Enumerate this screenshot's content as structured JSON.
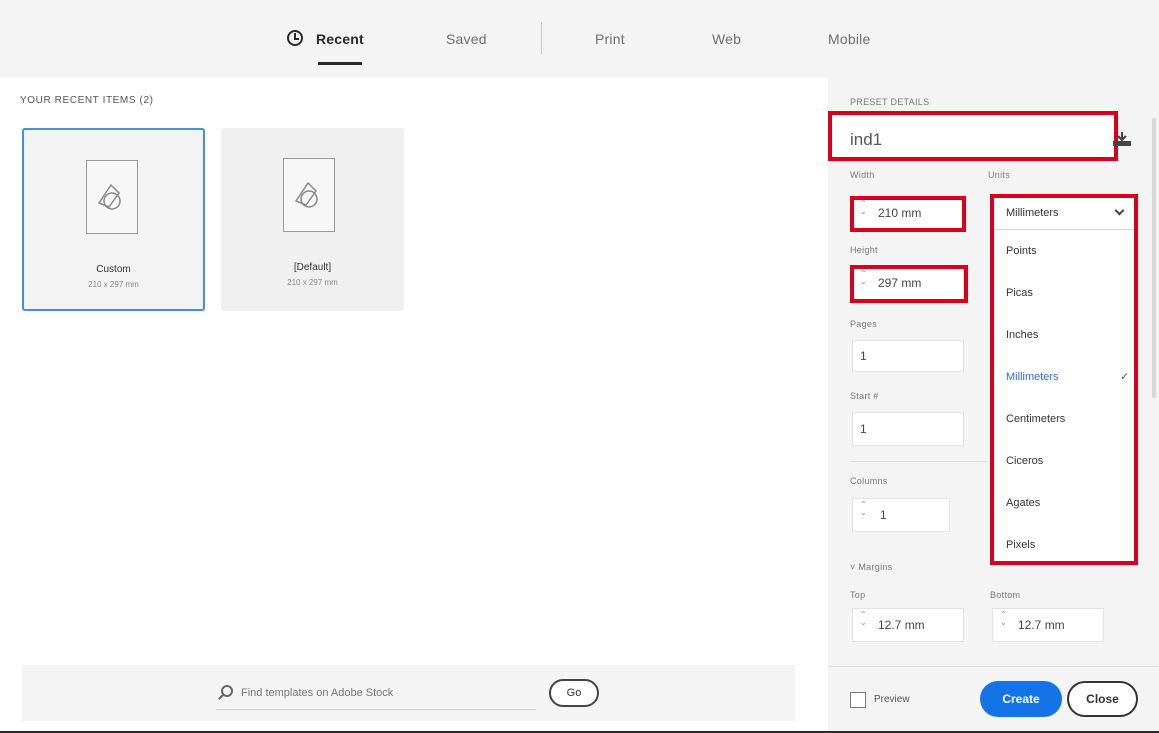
{
  "tabs": [
    {
      "label": "Recent",
      "active": true
    },
    {
      "label": "Saved",
      "active": false
    },
    {
      "label": "Print",
      "active": false
    },
    {
      "label": "Web",
      "active": false
    },
    {
      "label": "Mobile",
      "active": false
    }
  ],
  "recent": {
    "section_label": "YOUR RECENT ITEMS (2)",
    "items": [
      {
        "name": "Custom",
        "size": "210 x 297 mm"
      },
      {
        "name": "[Default]",
        "size": "210 x 297 mm"
      }
    ]
  },
  "search": {
    "placeholder": "Find templates on Adobe Stock",
    "go_label": "Go"
  },
  "preset": {
    "section_label": "PRESET DETAILS",
    "name": "ind1",
    "width_label": "Width",
    "width_value": "210 mm",
    "height_label": "Height",
    "height_value": "297 mm",
    "units_label": "Units",
    "pages_label": "Pages",
    "pages_value": "1",
    "start_label": "Start #",
    "start_value": "1",
    "columns_label": "Columns",
    "columns_value": "1",
    "margins_label": "Margins",
    "top_label": "Top",
    "top_value": "12.7 mm",
    "bottom_label": "Bottom",
    "bottom_value": "12.7 mm"
  },
  "units_dropdown": {
    "selected": "Millimeters",
    "options": [
      "Points",
      "Picas",
      "Inches",
      "Millimeters",
      "Centimeters",
      "Ciceros",
      "Agates",
      "Pixels"
    ]
  },
  "footer": {
    "preview_label": "Preview",
    "create_label": "Create",
    "close_label": "Close"
  },
  "colors": {
    "accent": "#1473e6",
    "highlight": "#d9001b",
    "selected_card": "#4b8be0"
  }
}
